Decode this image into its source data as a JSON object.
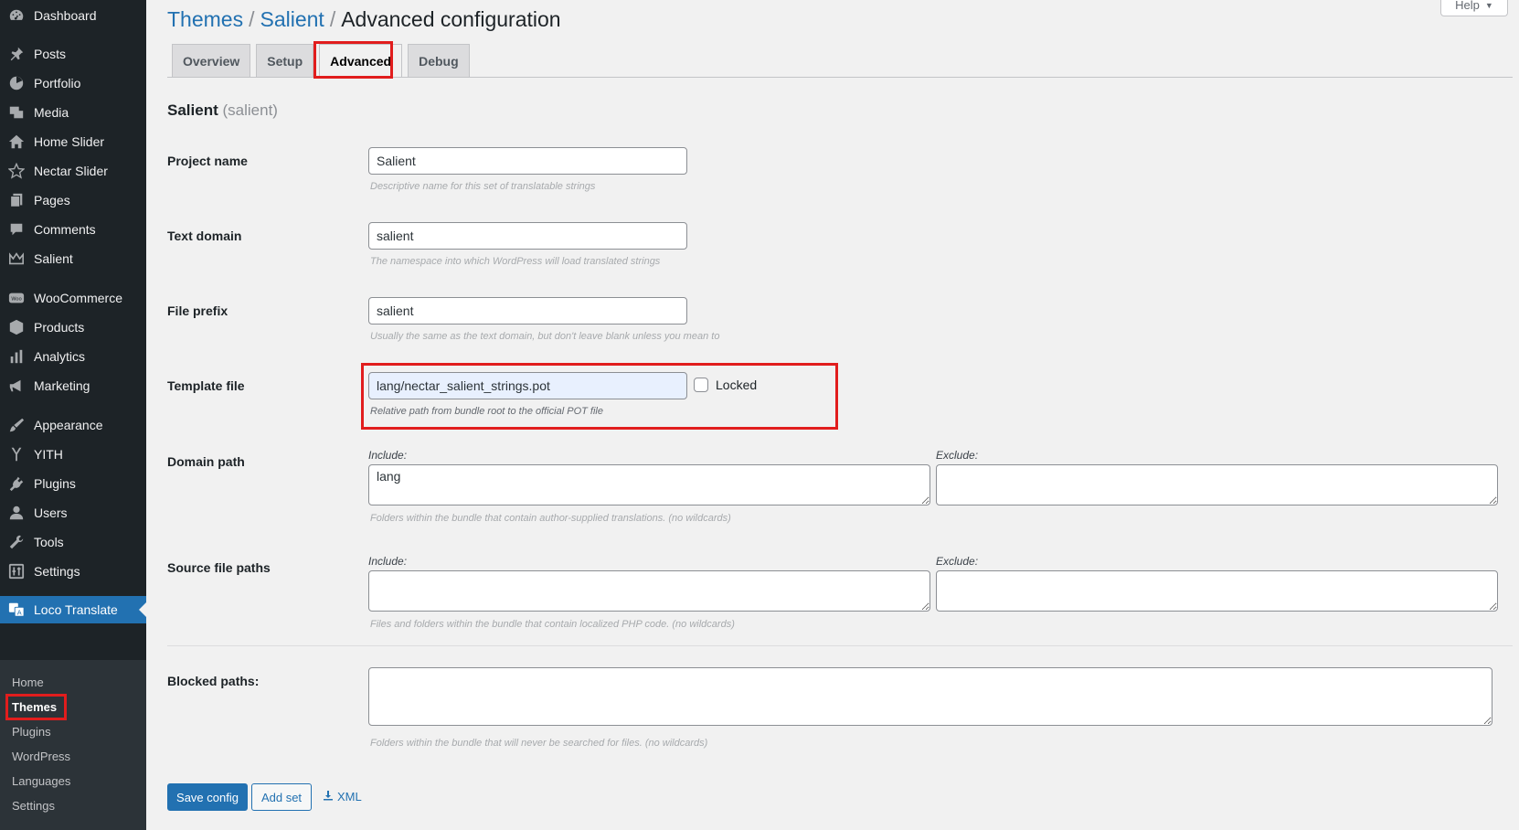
{
  "sidebar": {
    "items": [
      {
        "label": "Dashboard",
        "icon": "dashboard-icon"
      },
      {
        "label": "Posts",
        "icon": "pin-icon"
      },
      {
        "label": "Portfolio",
        "icon": "portfolio-icon"
      },
      {
        "label": "Media",
        "icon": "media-icon"
      },
      {
        "label": "Home Slider",
        "icon": "home-icon"
      },
      {
        "label": "Nectar Slider",
        "icon": "star-icon"
      },
      {
        "label": "Pages",
        "icon": "pages-icon"
      },
      {
        "label": "Comments",
        "icon": "comment-icon"
      },
      {
        "label": "Salient",
        "icon": "crown-icon"
      },
      {
        "label": "WooCommerce",
        "icon": "woo-icon"
      },
      {
        "label": "Products",
        "icon": "box-icon"
      },
      {
        "label": "Analytics",
        "icon": "bar-chart-icon"
      },
      {
        "label": "Marketing",
        "icon": "megaphone-icon"
      },
      {
        "label": "Appearance",
        "icon": "brush-icon"
      },
      {
        "label": "YITH",
        "icon": "yith-icon"
      },
      {
        "label": "Plugins",
        "icon": "plug-icon"
      },
      {
        "label": "Users",
        "icon": "user-icon"
      },
      {
        "label": "Tools",
        "icon": "wrench-icon"
      },
      {
        "label": "Settings",
        "icon": "settings-icon"
      },
      {
        "label": "Loco Translate",
        "icon": "translate-icon"
      }
    ],
    "submenu": [
      "Home",
      "Themes",
      "Plugins",
      "WordPress",
      "Languages",
      "Settings"
    ]
  },
  "breadcrumb": {
    "level1": "Themes",
    "level2": "Salient",
    "current": "Advanced configuration",
    "separator": "/"
  },
  "help": {
    "label": "Help",
    "arrow": "▼"
  },
  "tabs": [
    "Overview",
    "Setup",
    "Advanced",
    "Debug"
  ],
  "section": {
    "title": "Salient",
    "slug": "(salient)"
  },
  "form": {
    "project_name": {
      "label": "Project name",
      "value": "Salient",
      "desc": "Descriptive name for this set of translatable strings"
    },
    "text_domain": {
      "label": "Text domain",
      "value": "salient",
      "desc": "The namespace into which WordPress will load translated strings"
    },
    "file_prefix": {
      "label": "File prefix",
      "value": "salient",
      "desc": "Usually the same as the text domain, but don't leave blank unless you mean to"
    },
    "template_file": {
      "label": "Template file",
      "value": "lang/nectar_salient_strings.pot",
      "desc": "Relative path from bundle root to the official POT file",
      "locked_label": "Locked"
    },
    "domain_path": {
      "label": "Domain path",
      "include_label": "Include:",
      "exclude_label": "Exclude:",
      "include_value": "lang",
      "exclude_value": "",
      "desc": "Folders within the bundle that contain author-supplied translations. (no wildcards)"
    },
    "source_paths": {
      "label": "Source file paths",
      "include_label": "Include:",
      "exclude_label": "Exclude:",
      "include_value": "",
      "exclude_value": "",
      "desc": "Files and folders within the bundle that contain localized PHP code. (no wildcards)"
    },
    "blocked_paths": {
      "label": "Blocked paths:",
      "value": "",
      "desc": "Folders within the bundle that will never be searched for files. (no wildcards)"
    }
  },
  "buttons": {
    "save": "Save config",
    "add_set": "Add set",
    "xml": "XML"
  },
  "colors": {
    "accent": "#2271b1",
    "sidebar_bg": "#1d2327",
    "highlight": "#e11d1d"
  }
}
